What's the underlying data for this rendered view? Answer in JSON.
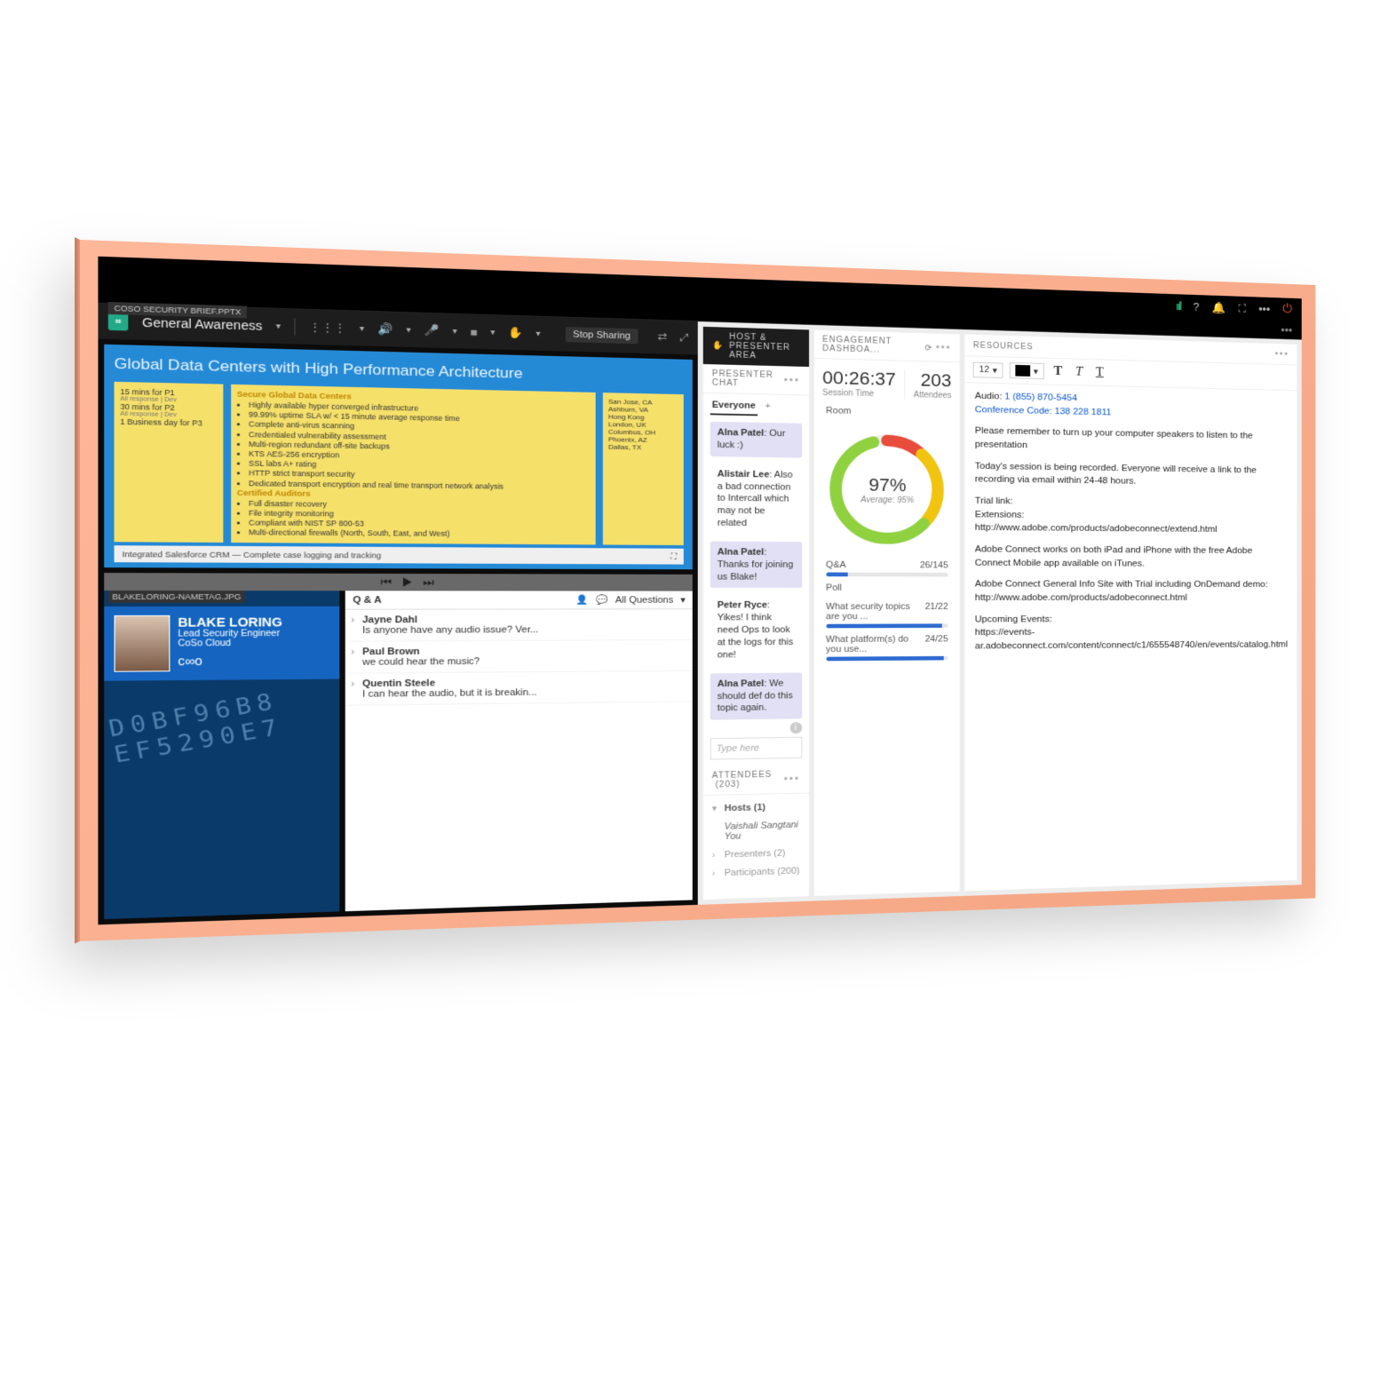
{
  "sysbar": {
    "signal": "ııll",
    "help": "?",
    "bell": "🔔",
    "full": "⛶",
    "more": "•••",
    "power": "⏻",
    "more2": "•••"
  },
  "toolbar": {
    "title": "General Awareness",
    "stop_sharing": "Stop Sharing"
  },
  "slide": {
    "file": "COSO SECURITY BRIEF.PPTX",
    "title": "Global Data Centers with High Performance Architecture",
    "left_times": [
      "15 mins for P1",
      "30 mins for P2",
      "1 Business day for P3"
    ],
    "mid_head": "Secure Global Data Centers",
    "mid_items": [
      "Highly available hyper converged infrastructure",
      "99.99% uptime SLA w/ < 15 minute average response time",
      "Complete anti-virus scanning",
      "Credentialed vulnerability assessment",
      "Multi-region redundant off-site backups",
      "KTS AES-256 encryption",
      "SSL labs A+ rating",
      "HTTP strict transport security",
      "Dedicated transport encryption and real time transport network analysis"
    ],
    "mid_head2": "Certified Auditors",
    "mid_items2": [
      "Full disaster recovery",
      "File integrity monitoring",
      "Compliant with NIST SP 800-53",
      "Multi-directional firewalls (North, South, East, and West)"
    ],
    "locs": [
      "San Jose, CA",
      "Ashburn, VA",
      "Hong Kong",
      "London, UK",
      "Columbus, OH",
      "Phoenix, AZ",
      "Dallas, TX"
    ],
    "int": "Integrated Salesforce CRM — Complete case logging and tracking"
  },
  "nametag": {
    "file": "BLAKELORING-NAMETAG.JPG",
    "name": "BLAKE LORING",
    "role": "Lead Security Engineer",
    "org": "CoSo Cloud",
    "digits": "D0BF96B8 EF5290E7"
  },
  "qa": {
    "title": "Q & A",
    "filter": "All Questions",
    "items": [
      {
        "name": "Jayne Dahl",
        "q": "Is anyone have any audio issue? Ver..."
      },
      {
        "name": "Paul Brown",
        "q": "we could hear the music?"
      },
      {
        "name": "Quentin Steele",
        "q": "I can hear the audio, but it is breakin..."
      }
    ]
  },
  "host_label": "HOST & PRESENTER AREA",
  "presenter_chat": {
    "title": "PRESENTER CHAT",
    "tab": "Everyone",
    "messages": [
      {
        "me": true,
        "from": "Alna Patel",
        "text": "Our luck :)"
      },
      {
        "me": false,
        "from": "Alistair Lee",
        "text": "Also a bad connection to Intercall which may not be related"
      },
      {
        "me": true,
        "from": "Alna Patel",
        "text": "Thanks for joining us Blake!"
      },
      {
        "me": false,
        "from": "Peter Ryce",
        "text": "Yikes! I think need Ops to look at the logs for this one!"
      },
      {
        "me": true,
        "from": "Alna Patel",
        "text": "We should def do this topic again."
      }
    ],
    "placeholder": "Type here"
  },
  "attendees": {
    "title": "ATTENDEES",
    "count": "(203)",
    "groups": [
      {
        "label": "Hosts (1)",
        "open": true,
        "members": [
          "Vaishali Sangtani You"
        ]
      },
      {
        "label": "Presenters (2)",
        "open": false
      },
      {
        "label": "Participants (200)",
        "open": false
      }
    ]
  },
  "dashboard": {
    "title": "ENGAGEMENT DASHBOA...",
    "session_time": "00:26:37",
    "session_label": "Session Time",
    "attendees": "203",
    "attendees_label": "Attendees",
    "room_label": "Room",
    "ring_pct": "97%",
    "ring_avg": "Average: 95%",
    "qa": {
      "label": "Q&A",
      "value": "26/145",
      "pct": 18
    },
    "poll_label": "Poll",
    "polls": [
      {
        "label": "What security topics are you ...",
        "value": "21/22",
        "pct": 95
      },
      {
        "label": "What platform(s) do you use...",
        "value": "24/25",
        "pct": 96
      }
    ]
  },
  "resources": {
    "title": "RESOURCES",
    "font_size": "12",
    "audio_label": "Audio:",
    "audio": "1 (855) 870-5454",
    "conf_label": "Conference Code:",
    "conf": "138 228 1811",
    "p1": "Please remember to turn up your computer speakers to listen to the presentation",
    "p2": "Today's session is being recorded. Everyone will receive a link to the recording via email within 24-48 hours.",
    "trial_label": "Trial link:",
    "ext_label": "Extensions:",
    "ext_url": "http://www.adobe.com/products/adobeconnect/extend.html",
    "p3": "Adobe Connect works on both iPad and iPhone with the free Adobe Connect Mobile app available on iTunes.",
    "p4": "Adobe Connect General Info Site with Trial including OnDemand demo:",
    "p4_url": "http://www.adobe.com/products/adobeconnect.html",
    "events_label": "Upcoming Events:",
    "events_url": "https://events-ar.adobeconnect.com/content/connect/c1/655548740/en/events/catalog.html"
  }
}
